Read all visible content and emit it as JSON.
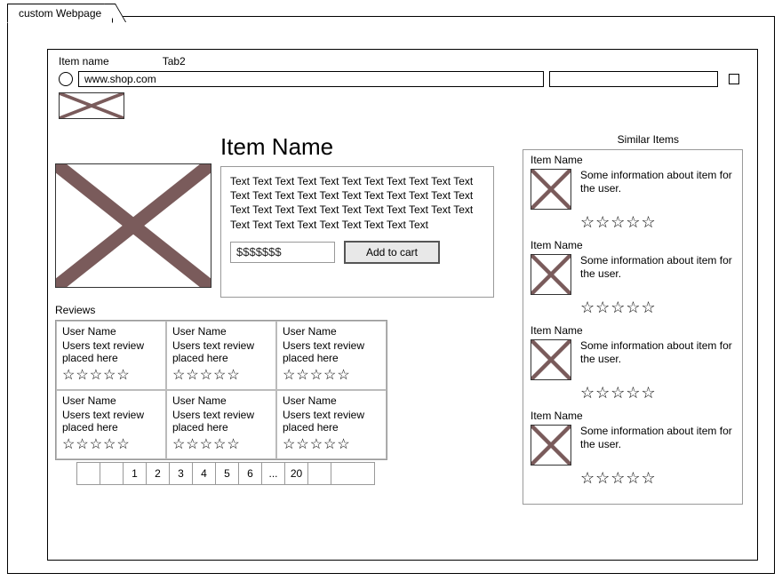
{
  "frame": {
    "label": "custom Webpage"
  },
  "tabs": {
    "tab1": "Item name",
    "tab2": "Tab2"
  },
  "address": {
    "url": "www.shop.com"
  },
  "product": {
    "title": "Item Name",
    "description": "Text Text Text Text Text Text Text Text Text Text Text Text Text Text Text Text Text Text Text Text Text Text Text Text Text Text Text Text Text Text Text Text Text Text Text Text Text Text Text Text Text Text",
    "price": "$$$$$$$",
    "add_to_cart": "Add to cart"
  },
  "reviews": {
    "heading": "Reviews",
    "items": [
      {
        "user": "User Name",
        "text": "Users text review placed here"
      },
      {
        "user": "User Name",
        "text": "Users text review placed here"
      },
      {
        "user": "User Name",
        "text": "Users text review placed here"
      },
      {
        "user": "User Name",
        "text": "Users text review placed here"
      },
      {
        "user": "User Name",
        "text": "Users text review placed here"
      },
      {
        "user": "User Name",
        "text": "Users text review placed here"
      }
    ],
    "pager": [
      "",
      "",
      "1",
      "2",
      "3",
      "4",
      "5",
      "6",
      "...",
      "20",
      "",
      ""
    ]
  },
  "similar": {
    "heading": "Similar Items",
    "items": [
      {
        "name": "Item Name",
        "info": "Some information about item for the user."
      },
      {
        "name": "Item Name",
        "info": "Some information about item for the user."
      },
      {
        "name": "Item Name",
        "info": "Some information about item for the user."
      },
      {
        "name": "Item Name",
        "info": "Some information about item for the user."
      }
    ]
  },
  "glyphs": {
    "star": "☆"
  }
}
